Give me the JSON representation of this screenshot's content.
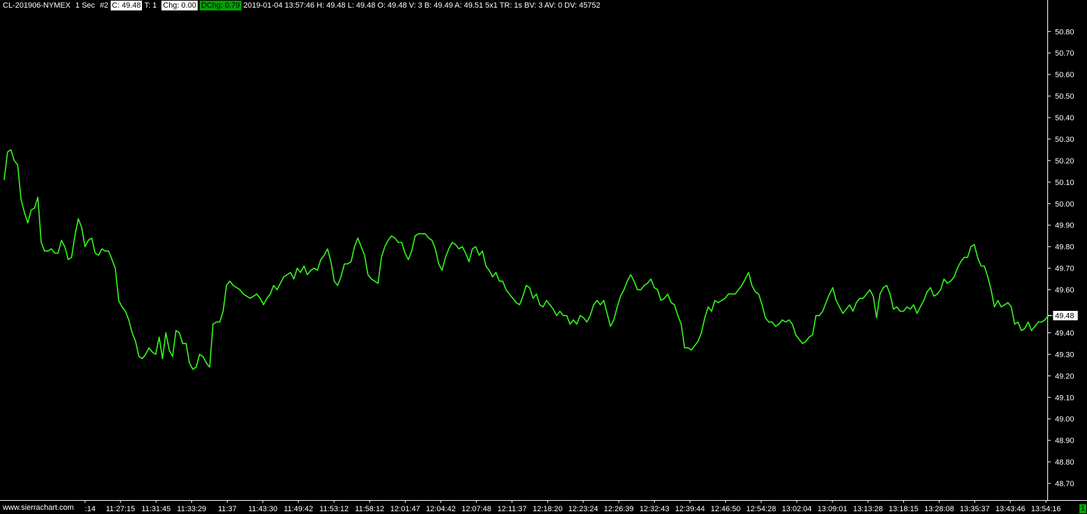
{
  "header": {
    "symbol": "CL-201906-NYMEX",
    "timeframe": "1 Sec",
    "chart_no": "#2",
    "close": "C: 49.48",
    "trades": "T: 1",
    "chg": "Chg: 0.00",
    "dchg": "DChg: 0.79",
    "details": "2019-01-04 13:57:46 H: 49.48 L: 49.48 O: 49.48 V: 3 B: 49.49 A: 49.51 5x1 TR: 1s BV: 3 AV: 0 DV: 45752"
  },
  "watermark": "www.sierrachart.com",
  "corner_label": "1",
  "colors": {
    "line": "#33ff1a",
    "axis": "#ffffff",
    "bg": "#000000",
    "price_box_bg": "#ffffff"
  },
  "chart_data": {
    "type": "line",
    "ylim": [
      48.65,
      50.88
    ],
    "yticks": [
      "50.80",
      "50.70",
      "50.60",
      "50.50",
      "50.40",
      "50.30",
      "50.20",
      "50.10",
      "50.00",
      "49.90",
      "49.80",
      "49.70",
      "49.60",
      "49.48",
      "49.40",
      "49.30",
      "49.20",
      "49.10",
      "49.00",
      "48.90",
      "48.80",
      "48.70"
    ],
    "xticks": [
      ":14",
      "11:27:15",
      "11:31:45",
      "11:33:29",
      "11:37",
      "11:43:30",
      "11:49:42",
      "11:53:12",
      "11:58:12",
      "12:01:47",
      "12:04:42",
      "12:07:48",
      "12:11:37",
      "12:18:20",
      "12:23:24",
      "12:26:39",
      "12:32:43",
      "12:39:44",
      "12:46:50",
      "12:54:28",
      "13:02:04",
      "13:09:01",
      "13:13:28",
      "13:18:15",
      "13:28:08",
      "13:35:37",
      "13:43:46",
      "13:54:16"
    ],
    "last_price": "49.48",
    "series": [
      {
        "values": [
          50.11,
          50.24,
          50.25,
          50.2,
          50.18,
          50.02,
          49.96,
          49.91,
          49.97,
          49.98,
          50.03,
          49.82,
          49.78,
          49.78,
          49.79,
          49.77,
          49.77,
          49.83,
          49.8,
          49.74,
          49.75,
          49.85,
          49.93,
          49.89,
          49.8,
          49.83,
          49.84,
          49.77,
          49.76,
          49.79,
          49.78,
          49.78,
          49.74,
          49.7,
          49.55,
          49.52,
          49.5,
          49.46,
          49.4,
          49.36,
          49.29,
          49.28,
          49.3,
          49.33,
          49.31,
          49.3,
          49.38,
          49.28,
          49.4,
          49.32,
          49.29,
          49.41,
          49.4,
          49.35,
          49.35,
          49.26,
          49.23,
          49.24,
          49.3,
          49.29,
          49.26,
          49.24,
          49.44,
          49.45,
          49.45,
          49.5,
          49.62,
          49.64,
          49.62,
          49.61,
          49.6,
          49.58,
          49.57,
          49.56,
          49.57,
          49.58,
          49.56,
          49.53,
          49.56,
          49.58,
          49.62,
          49.6,
          49.63,
          49.66,
          49.67,
          49.68,
          49.65,
          49.7,
          49.68,
          49.71,
          49.67,
          49.69,
          49.7,
          49.69,
          49.74,
          49.76,
          49.79,
          49.73,
          49.64,
          49.62,
          49.66,
          49.72,
          49.72,
          49.73,
          49.8,
          49.84,
          49.8,
          49.76,
          49.67,
          49.65,
          49.64,
          49.63,
          49.75,
          49.8,
          49.83,
          49.85,
          49.84,
          49.82,
          49.82,
          49.77,
          49.74,
          49.78,
          49.85,
          49.86,
          49.86,
          49.86,
          49.84,
          49.83,
          49.79,
          49.72,
          49.69,
          49.75,
          49.79,
          49.82,
          49.81,
          49.79,
          49.8,
          49.77,
          49.73,
          49.79,
          49.8,
          49.76,
          49.78,
          49.71,
          49.69,
          49.66,
          49.68,
          49.64,
          49.64,
          49.6,
          49.58,
          49.56,
          49.54,
          49.53,
          49.57,
          49.62,
          49.61,
          49.56,
          49.58,
          49.53,
          49.52,
          49.55,
          49.53,
          49.51,
          49.48,
          49.5,
          49.48,
          49.48,
          49.44,
          49.46,
          49.44,
          49.48,
          49.47,
          49.45,
          49.48,
          49.53,
          49.55,
          49.53,
          49.55,
          49.49,
          49.43,
          49.46,
          49.52,
          49.57,
          49.6,
          49.64,
          49.67,
          49.64,
          49.6,
          49.6,
          49.62,
          49.63,
          49.65,
          49.61,
          49.6,
          49.55,
          49.56,
          49.58,
          49.54,
          49.53,
          49.48,
          49.44,
          49.33,
          49.33,
          49.32,
          49.34,
          49.36,
          49.4,
          49.47,
          49.52,
          49.5,
          49.55,
          49.54,
          49.55,
          49.56,
          49.58,
          49.58,
          49.58,
          49.6,
          49.62,
          49.65,
          49.68,
          49.62,
          49.59,
          49.58,
          49.53,
          49.47,
          49.45,
          49.45,
          49.43,
          49.44,
          49.46,
          49.45,
          49.46,
          49.44,
          49.39,
          49.37,
          49.35,
          49.36,
          49.38,
          49.39,
          49.48,
          49.48,
          49.5,
          49.54,
          49.58,
          49.61,
          49.55,
          49.52,
          49.49,
          49.51,
          49.53,
          49.5,
          49.54,
          49.56,
          49.56,
          49.58,
          49.6,
          49.57,
          49.47,
          49.58,
          49.61,
          49.62,
          49.58,
          49.51,
          49.52,
          49.5,
          49.5,
          49.52,
          49.51,
          49.53,
          49.49,
          49.52,
          49.55,
          49.59,
          49.61,
          49.57,
          49.58,
          49.6,
          49.65,
          49.63,
          49.64,
          49.66,
          49.7,
          49.73,
          49.75,
          49.75,
          49.8,
          49.81,
          49.75,
          49.71,
          49.71,
          49.66,
          49.6,
          49.52,
          49.55,
          49.52,
          49.53,
          49.54,
          49.52,
          49.44,
          49.45,
          49.41,
          49.42,
          49.45,
          49.41,
          49.43,
          49.45,
          49.45,
          49.46,
          49.48,
          49.48,
          49.48,
          49.48
        ]
      }
    ]
  }
}
